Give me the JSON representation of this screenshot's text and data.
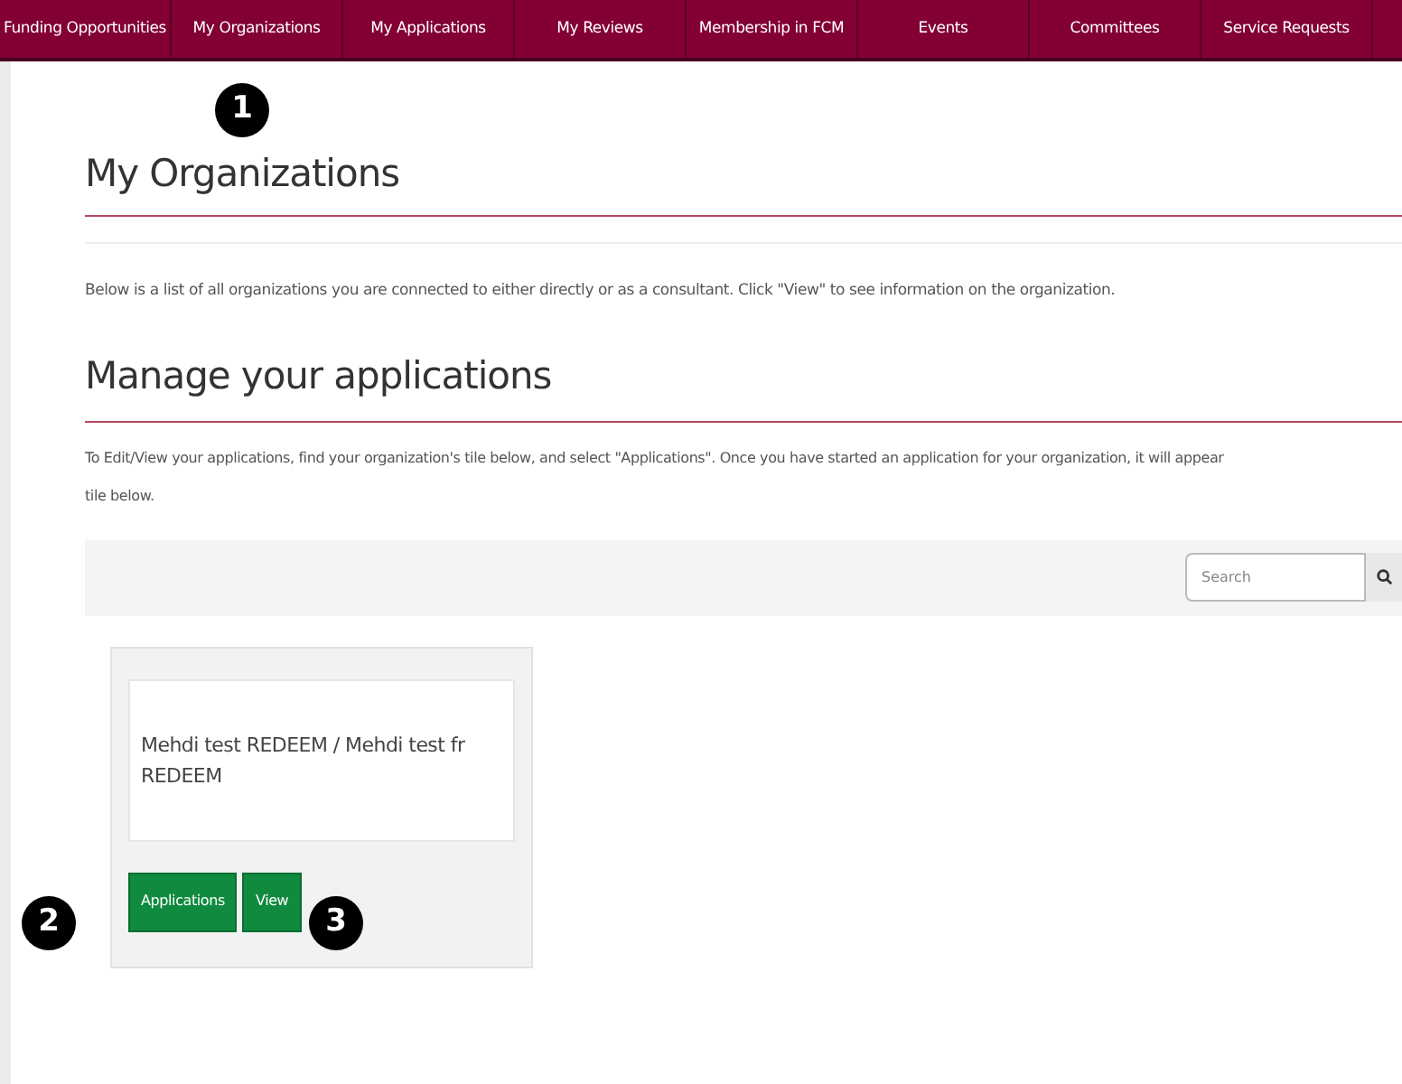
{
  "nav": [
    {
      "label": "Funding Opportunities"
    },
    {
      "label": "My Organizations"
    },
    {
      "label": "My Applications"
    },
    {
      "label": "My Reviews"
    },
    {
      "label": "Membership in FCM"
    },
    {
      "label": "Events"
    },
    {
      "label": "Committees"
    },
    {
      "label": "Service Requests"
    }
  ],
  "title": "My Organizations",
  "intro": "Below is a list of all organizations you are connected to either directly or as a consultant. Click \"View\" to see information on the organization.",
  "section_title": "Manage your applications",
  "instructions": [
    "To Edit/View your applications, find your organization's tile below, and select \"Applications\". Once you have started an application for your organization, it will appear",
    "tile below."
  ],
  "search": {
    "placeholder": "Search"
  },
  "tiles": [
    {
      "name": "Mehdi test REDEEM / Mehdi test fr REDEEM",
      "buttons": [
        "Applications",
        "View"
      ]
    }
  ],
  "callouts": [
    "1",
    "2",
    "3"
  ]
}
